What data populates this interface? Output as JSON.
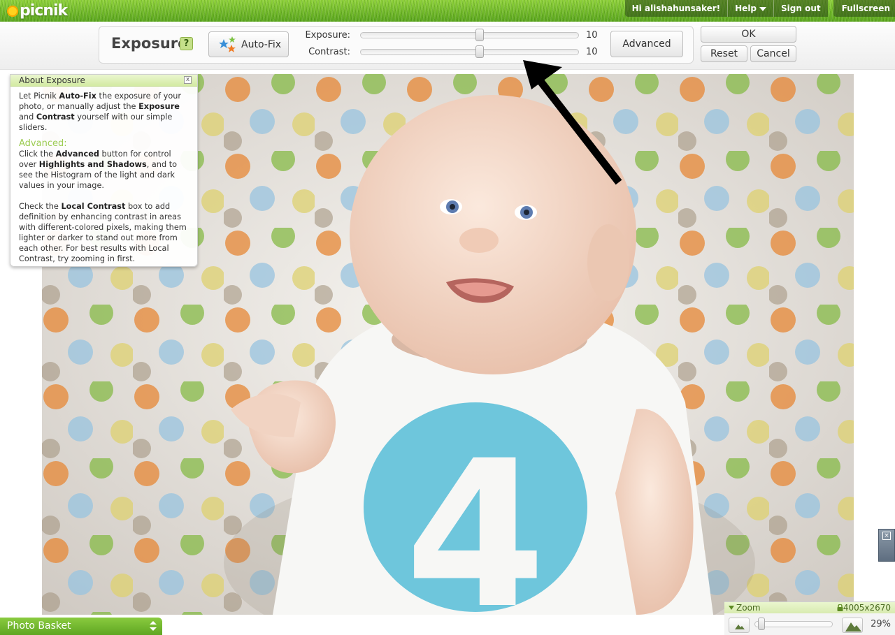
{
  "app": {
    "logo_text": "picnik"
  },
  "top_links": {
    "greeting": "Hi alishahunsaker!",
    "help": "Help",
    "sign_out": "Sign out",
    "fullscreen": "Fullscreen"
  },
  "tool": {
    "title": "Exposure",
    "help_label": "?",
    "autofix_label": "Auto-Fix",
    "advanced_label": "Advanced",
    "ok_label": "OK",
    "reset_label": "Reset",
    "cancel_label": "Cancel",
    "sliders": [
      {
        "label": "Exposure:",
        "value": "10",
        "fraction": 0.55
      },
      {
        "label": "Contrast:",
        "value": "10",
        "fraction": 0.55
      }
    ]
  },
  "about": {
    "title": "About Exposure",
    "close": "x",
    "p1_pre": "Let Picnik ",
    "p1_b1": "Auto-Fix",
    "p1_mid1": " the exposure of your photo, or manually adjust the ",
    "p1_b2": "Exposure",
    "p1_mid2": " and ",
    "p1_b3": "Contrast",
    "p1_post": " yourself with our simple sliders.",
    "advanced_heading": "Advanced:",
    "p2_pre": "Click the ",
    "p2_b1": "Advanced",
    "p2_mid": " button for control over ",
    "p2_b2": "Highlights and Shadows",
    "p2_post": ", and to see the Histogram of the light and dark values in your image.",
    "p3_pre": "Check the ",
    "p3_b1": "Local Contrast",
    "p3_post": " box to add definition by enhancing contrast in areas with different-colored pixels, making them lighter or darker to stand out more from each other. For best results with Local Contrast, try zooming in first."
  },
  "photo": {
    "shirt_number": "4"
  },
  "photo_basket": {
    "label": "Photo Basket"
  },
  "zoom": {
    "label": "Zoom",
    "dimensions": "4005x2670",
    "percent": "29%",
    "level": 0.04
  },
  "colors": {
    "grass_green": "#6bb42a",
    "accent_green": "#9ccc52",
    "shirt_blue": "#6ec6dc"
  }
}
